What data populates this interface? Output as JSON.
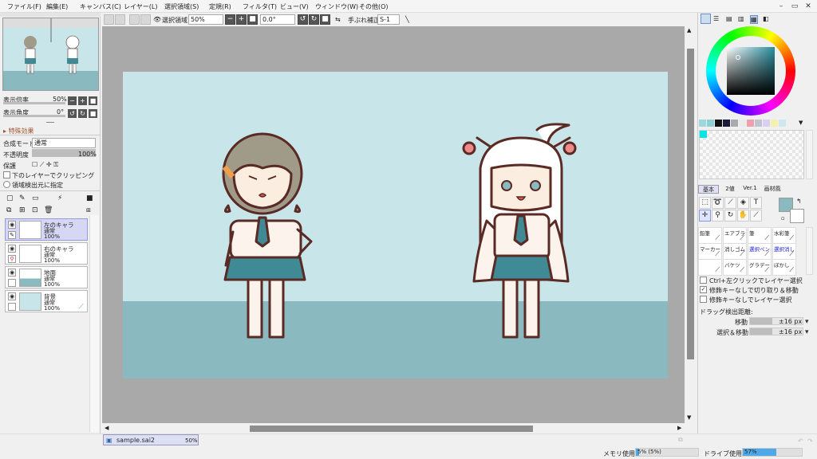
{
  "menu": [
    "ファイル(F)",
    "編集(E)",
    "キャンバス(C)",
    "レイヤー(L)",
    "選択領域(S)",
    "定規(R)",
    "フィルタ(T)",
    "ビュー(V)",
    "ウィンドウ(W)",
    "その他(O)"
  ],
  "toolbar": {
    "selection_label": "選択領域",
    "zoom_value": "50%",
    "angle_value": "0.0°",
    "stabilizer_label": "手ぶれ補正",
    "stabilizer_value": "S-1"
  },
  "navigator": {
    "zoom_label": "表示倍率",
    "zoom_value": "50%",
    "angle_label": "表示角度",
    "angle_value": "0°"
  },
  "effects": {
    "label": "特殊効果"
  },
  "layer_props": {
    "blend_label": "合成モード",
    "blend_value": "通常",
    "opacity_label": "不透明度",
    "opacity_value": "100%",
    "protect_label": "保護",
    "clip_label": "下のレイヤーでクリッピング",
    "source_label": "領域検出元に指定"
  },
  "layers": [
    {
      "name": "左のキャラ",
      "mode": "通常",
      "opacity": "100%",
      "selected": true
    },
    {
      "name": "右のキャラ",
      "mode": "通常",
      "opacity": "100%",
      "selected": false
    },
    {
      "name": "地面",
      "mode": "通常",
      "opacity": "100%",
      "selected": false
    },
    {
      "name": "背景",
      "mode": "通常",
      "opacity": "100%",
      "selected": false
    }
  ],
  "tabs": [
    "基本",
    "2値",
    "Ver.1",
    "画材風"
  ],
  "brushes": [
    {
      "name": "鉛筆"
    },
    {
      "name": "エアブラシ"
    },
    {
      "name": "筆"
    },
    {
      "name": "水彩筆"
    },
    {
      "name": "マーカー"
    },
    {
      "name": "消しゴム"
    },
    {
      "name": "選択ペン"
    },
    {
      "name": "選択消し"
    },
    {
      "name": ""
    },
    {
      "name": "バケツ"
    },
    {
      "name": "グラデー"
    },
    {
      "name": "ぼかし"
    }
  ],
  "options": {
    "opt1": "Ctrl+左クリックでレイヤー選択",
    "opt2": "修飾キーなしで切り取り＆移動",
    "opt3": "修飾キーなしでレイヤー選択",
    "drag_label": "ドラッグ検出距離:",
    "move_label": "移動",
    "move_value": "±16 px",
    "selmove_label": "選択＆移動",
    "selmove_value": "±16 px"
  },
  "document": {
    "name": "sample.sai2",
    "zoom": "50%"
  },
  "status": {
    "mem_label": "メモリ使用量",
    "mem_value": "5% (5%)",
    "mem_fraction": 0.05,
    "drive_label": "ドライブ使用量",
    "drive_value": "57%",
    "drive_fraction": 0.57
  },
  "colors": {
    "sky": "#c8e6ea",
    "ground": "#8ab9c0",
    "skirt": "#3f8a95",
    "outline": "#5a2a24",
    "accent_layer": "#d6d6f5"
  },
  "swatches": [
    "#9ed8dc",
    "#8fcfd6",
    "#111111",
    "#1a1a3a",
    "#a8aab0",
    "#ececec",
    "#ee9fb0",
    "#c0c4ce",
    "#d8d0ee",
    "#f4f0b0",
    "#cfe8f0"
  ]
}
